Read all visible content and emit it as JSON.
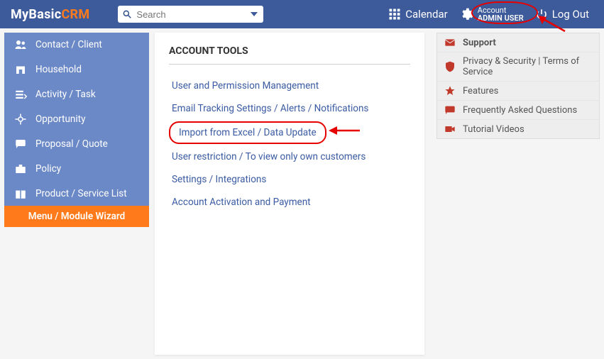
{
  "brand": {
    "part1": "MyBasic",
    "part2": "CRM"
  },
  "search": {
    "placeholder": "Search"
  },
  "topnav": {
    "calendar": "Calendar",
    "account_label": "Account",
    "account_user": "ADMIN USER",
    "logout": "Log Out"
  },
  "sidebar": {
    "items": [
      {
        "label": "Contact / Client"
      },
      {
        "label": "Household"
      },
      {
        "label": "Activity / Task"
      },
      {
        "label": "Opportunity"
      },
      {
        "label": "Proposal / Quote"
      },
      {
        "label": "Policy"
      },
      {
        "label": "Product / Service List"
      }
    ],
    "wizard": "Menu / Module Wizard"
  },
  "main": {
    "title": "ACCOUNT TOOLS",
    "links": [
      "User and Permission Management",
      "Email Tracking Settings / Alerts / Notifications",
      "Import from Excel / Data Update",
      "User restriction / To view only own customers",
      "Settings / Integrations",
      "Account Activation and Payment"
    ]
  },
  "right_menu": {
    "items": [
      {
        "label": "Support",
        "bold": true,
        "color": "#c0392b"
      },
      {
        "label": "Privacy & Security | Terms of Service",
        "color": "#c0392b"
      },
      {
        "label": "Features",
        "color": "#c0392b"
      },
      {
        "label": "Frequently Asked Questions",
        "color": "#c0392b"
      },
      {
        "label": "Tutorial Videos",
        "color": "#c0392b"
      }
    ]
  }
}
